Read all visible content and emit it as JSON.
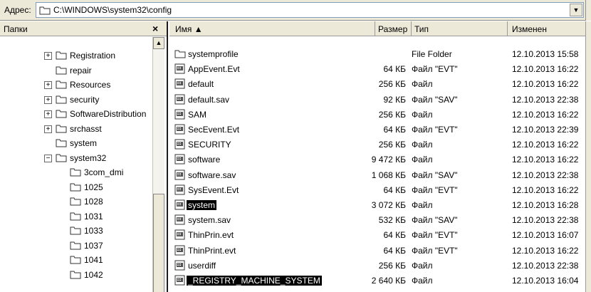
{
  "address_bar": {
    "label": "Адрес:",
    "path": "C:\\WINDOWS\\system32\\config"
  },
  "folders_pane": {
    "title": "Папки",
    "close": "×",
    "items": [
      {
        "label": "Registration",
        "expander": "+",
        "level": 1
      },
      {
        "label": "repair",
        "expander": "",
        "level": 1
      },
      {
        "label": "Resources",
        "expander": "+",
        "level": 1
      },
      {
        "label": "security",
        "expander": "+",
        "level": 1
      },
      {
        "label": "SoftwareDistribution",
        "expander": "+",
        "level": 1
      },
      {
        "label": "srchasst",
        "expander": "+",
        "level": 1
      },
      {
        "label": "system",
        "expander": "",
        "level": 1
      },
      {
        "label": "system32",
        "expander": "−",
        "level": 1
      },
      {
        "label": "3com_dmi",
        "expander": "",
        "level": 2
      },
      {
        "label": "1025",
        "expander": "",
        "level": 2
      },
      {
        "label": "1028",
        "expander": "",
        "level": 2
      },
      {
        "label": "1031",
        "expander": "",
        "level": 2
      },
      {
        "label": "1033",
        "expander": "",
        "level": 2
      },
      {
        "label": "1037",
        "expander": "",
        "level": 2
      },
      {
        "label": "1041",
        "expander": "",
        "level": 2
      },
      {
        "label": "1042",
        "expander": "",
        "level": 2
      }
    ]
  },
  "file_list": {
    "columns": {
      "name": "Имя ▲",
      "size": "Размер",
      "type": "Тип",
      "modified": "Изменен"
    },
    "rows": [
      {
        "name": "systemprofile",
        "size": "",
        "type": "File Folder",
        "modified": "12.10.2013 15:58",
        "icon": "folder",
        "selected": false
      },
      {
        "name": "AppEvent.Evt",
        "size": "64 КБ",
        "type": "Файл \"EVT\"",
        "modified": "12.10.2013 16:22",
        "icon": "file",
        "selected": false
      },
      {
        "name": "default",
        "size": "256 КБ",
        "type": "Файл",
        "modified": "12.10.2013 16:22",
        "icon": "file",
        "selected": false
      },
      {
        "name": "default.sav",
        "size": "92 КБ",
        "type": "Файл \"SAV\"",
        "modified": "12.10.2013 22:38",
        "icon": "file",
        "selected": false
      },
      {
        "name": "SAM",
        "size": "256 КБ",
        "type": "Файл",
        "modified": "12.10.2013 16:22",
        "icon": "file",
        "selected": false
      },
      {
        "name": "SecEvent.Evt",
        "size": "64 КБ",
        "type": "Файл \"EVT\"",
        "modified": "12.10.2013 22:39",
        "icon": "file",
        "selected": false
      },
      {
        "name": "SECURITY",
        "size": "256 КБ",
        "type": "Файл",
        "modified": "12.10.2013 16:22",
        "icon": "file",
        "selected": false
      },
      {
        "name": "software",
        "size": "9 472 КБ",
        "type": "Файл",
        "modified": "12.10.2013 16:22",
        "icon": "file",
        "selected": false
      },
      {
        "name": "software.sav",
        "size": "1 068 КБ",
        "type": "Файл \"SAV\"",
        "modified": "12.10.2013 22:38",
        "icon": "file",
        "selected": false
      },
      {
        "name": "SysEvent.Evt",
        "size": "64 КБ",
        "type": "Файл \"EVT\"",
        "modified": "12.10.2013 16:22",
        "icon": "file",
        "selected": false
      },
      {
        "name": "system",
        "size": "3 072 КБ",
        "type": "Файл",
        "modified": "12.10.2013 16:28",
        "icon": "file",
        "selected": true
      },
      {
        "name": "system.sav",
        "size": "532 КБ",
        "type": "Файл \"SAV\"",
        "modified": "12.10.2013 22:38",
        "icon": "file",
        "selected": false
      },
      {
        "name": "ThinPrin.evt",
        "size": "64 КБ",
        "type": "Файл \"EVT\"",
        "modified": "12.10.2013 16:07",
        "icon": "file",
        "selected": false
      },
      {
        "name": "ThinPrint.evt",
        "size": "64 КБ",
        "type": "Файл \"EVT\"",
        "modified": "12.10.2013 16:22",
        "icon": "file",
        "selected": false
      },
      {
        "name": "userdiff",
        "size": "256 КБ",
        "type": "Файл",
        "modified": "12.10.2013 22:38",
        "icon": "file",
        "selected": false
      },
      {
        "name": "_REGISTRY_MACHINE_SYSTEM",
        "size": "2 640 КБ",
        "type": "Файл",
        "modified": "12.10.2013 16:04",
        "icon": "file",
        "selected": true
      }
    ]
  }
}
